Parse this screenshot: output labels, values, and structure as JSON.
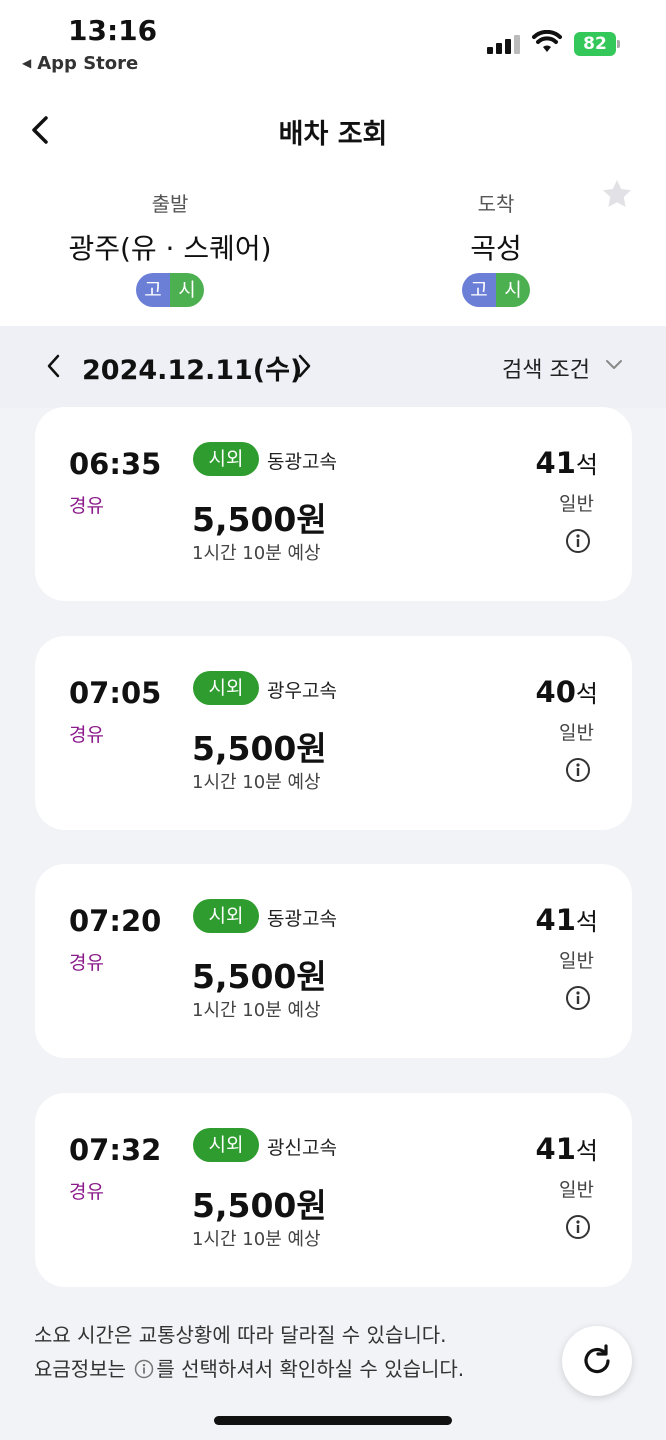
{
  "status": {
    "time": "13:16",
    "back_app": "App Store",
    "battery": "82"
  },
  "header": {
    "title": "배차 조회"
  },
  "departure": {
    "label": "출발",
    "name": "광주(유 · 스퀘어)",
    "badges": [
      "고",
      "시"
    ]
  },
  "arrival": {
    "label": "도착",
    "name": "곡성",
    "badges": [
      "고",
      "시"
    ]
  },
  "date_bar": {
    "date": "2024.12.11(수)",
    "search_conditions": "검색 조건"
  },
  "schedules": [
    {
      "time": "06:35",
      "route_type": "경유",
      "class_badge": "시외",
      "company": "동광고속",
      "fare": "5,500원",
      "duration": "1시간 10분 예상",
      "seats": "41",
      "seat_unit": "석",
      "bus_class": "일반"
    },
    {
      "time": "07:05",
      "route_type": "경유",
      "class_badge": "시외",
      "company": "광우고속",
      "fare": "5,500원",
      "duration": "1시간 10분 예상",
      "seats": "40",
      "seat_unit": "석",
      "bus_class": "일반"
    },
    {
      "time": "07:20",
      "route_type": "경유",
      "class_badge": "시외",
      "company": "동광고속",
      "fare": "5,500원",
      "duration": "1시간 10분 예상",
      "seats": "41",
      "seat_unit": "석",
      "bus_class": "일반"
    },
    {
      "time": "07:32",
      "route_type": "경유",
      "class_badge": "시외",
      "company": "광신고속",
      "fare": "5,500원",
      "duration": "1시간 10분 예상",
      "seats": "41",
      "seat_unit": "석",
      "bus_class": "일반"
    }
  ],
  "notice": {
    "line1": "소요 시간은 교통상황에 따라 달라질 수 있습니다.",
    "line2_before": "요금정보는",
    "line2_after": "를 선택하셔서 확인하실 수 있습니다."
  },
  "colors": {
    "route_type": "#8b1a8b",
    "class_badge": "#2e9c2e",
    "badge_go": "#6b7fd7",
    "badge_si": "#4caf50",
    "battery": "#34c759"
  },
  "icons": [
    "back-arrow-icon",
    "star-icon",
    "chevron-left-icon",
    "chevron-right-icon",
    "chevron-down-icon",
    "info-icon",
    "refresh-icon",
    "wifi-icon",
    "signal-icon"
  ]
}
